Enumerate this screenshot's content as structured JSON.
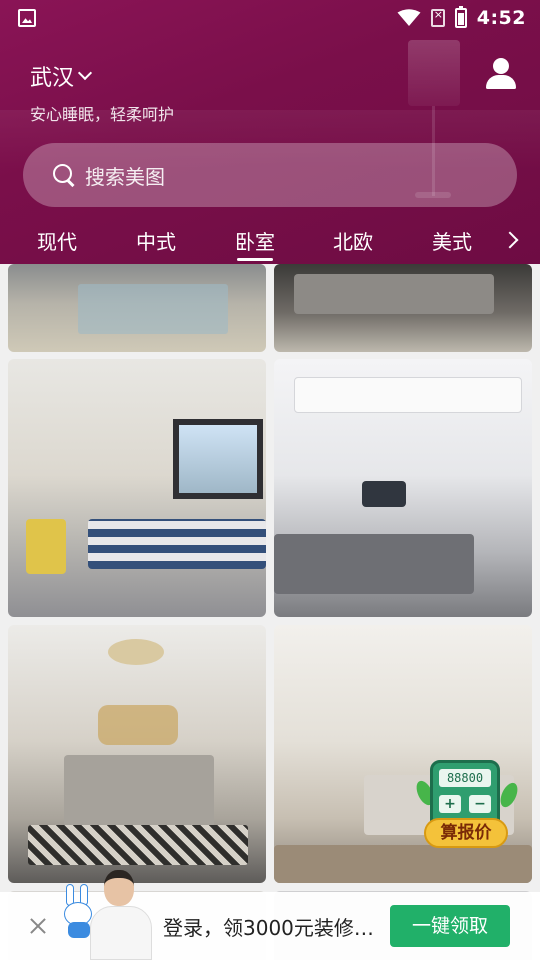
{
  "status_bar": {
    "time": "4:52",
    "icons": [
      "image-icon",
      "wifi-icon",
      "sim-icon",
      "battery-icon"
    ]
  },
  "header": {
    "city": "武汉",
    "slogan": "安心睡眠，轻柔呵护",
    "search_placeholder": "搜索美图",
    "tabs": [
      {
        "label": "现代",
        "active": false
      },
      {
        "label": "中式",
        "active": false
      },
      {
        "label": "卧室",
        "active": true
      },
      {
        "label": "北欧",
        "active": false
      },
      {
        "label": "美式",
        "active": false
      }
    ],
    "colors": {
      "accent": "#7e1150",
      "tab_underline": "#ffffff"
    }
  },
  "gallery": {
    "items": [
      {
        "room": "bedroom"
      },
      {
        "room": "bedroom"
      },
      {
        "room": "bedroom"
      },
      {
        "room": "bedroom"
      },
      {
        "room": "bedroom"
      },
      {
        "room": "bedroom"
      },
      {
        "room": "bedroom"
      },
      {
        "room": "bedroom"
      }
    ]
  },
  "quote_widget": {
    "display": "88800",
    "plus": "+",
    "minus": "−",
    "label": "算报价"
  },
  "banner": {
    "text": "登录，领3000元装修…",
    "button": "一键领取",
    "button_color": "#21b069"
  }
}
